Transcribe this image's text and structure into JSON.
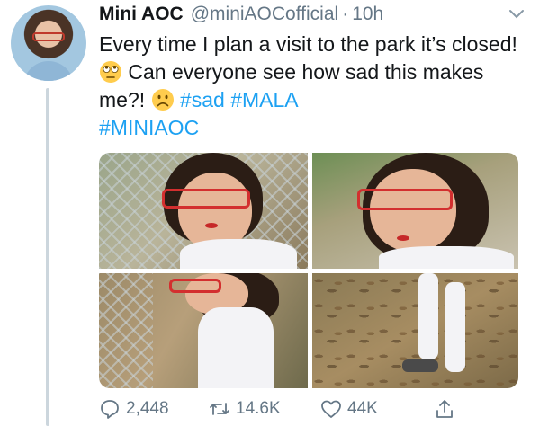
{
  "tweet": {
    "display_name": "Mini AOC",
    "handle": "@miniAOCofficial",
    "separator": "·",
    "time": "10h",
    "text": {
      "part1": "Every time I plan a visit to the park it’s closed! ",
      "part2": " Can everyone see how sad this makes me?! ",
      "part3": " ",
      "hashtag_sad": "#sad",
      "hashtag_mala": "#MALA",
      "hashtag_miniaoc": "#MINIAOC"
    },
    "emoji_1": "face-with-rolling-eyes",
    "emoji_2": "frowning-face"
  },
  "actions": {
    "reply_count": "2,448",
    "retweet_count": "14.6K",
    "like_count": "44K"
  },
  "icons": {
    "menu": "chevron-down-icon",
    "reply": "reply-icon",
    "retweet": "retweet-icon",
    "like": "heart-icon",
    "share": "share-icon"
  },
  "colors": {
    "hashtag": "#1da1f2",
    "secondary_text": "#657786",
    "thread_line": "#ccd6dd"
  }
}
